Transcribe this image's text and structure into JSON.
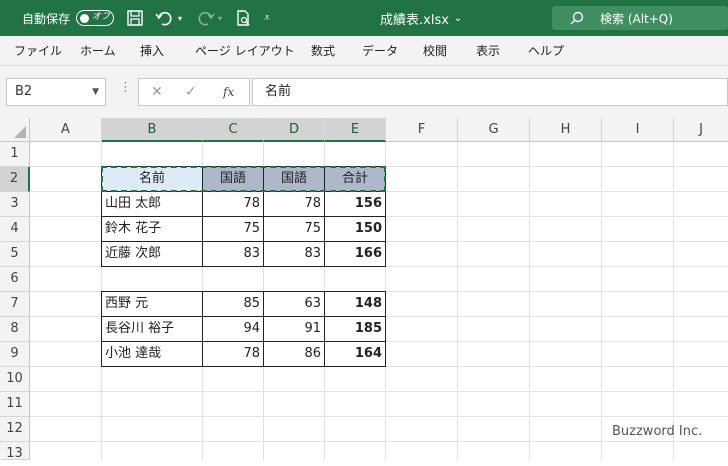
{
  "titlebar": {
    "autosave_label": "自動保存",
    "autosave_state": "オフ",
    "filename": "成績表.xlsx",
    "search_placeholder": "検索 (Alt+Q)"
  },
  "ribbon": {
    "tabs": [
      "ファイル",
      "ホーム",
      "挿入",
      "ページ レイアウト",
      "数式",
      "データ",
      "校閲",
      "表示",
      "ヘルプ"
    ]
  },
  "formula_bar": {
    "name_box": "B2",
    "fx_label": "fx",
    "content": "名前"
  },
  "columns": [
    "A",
    "B",
    "C",
    "D",
    "E",
    "F",
    "G",
    "H",
    "I",
    "J"
  ],
  "rows": [
    "1",
    "2",
    "3",
    "4",
    "5",
    "6",
    "7",
    "8",
    "9",
    "10",
    "11",
    "12",
    "13"
  ],
  "table": {
    "header": [
      "名前",
      "国語",
      "国語",
      "合計"
    ],
    "group1": [
      {
        "name": "山田 太郎",
        "c": "78",
        "d": "78",
        "total": "156"
      },
      {
        "name": "鈴木 花子",
        "c": "75",
        "d": "75",
        "total": "150"
      },
      {
        "name": "近藤 次郎",
        "c": "83",
        "d": "83",
        "total": "166"
      }
    ],
    "group2": [
      {
        "name": "西野 元",
        "c": "85",
        "d": "63",
        "total": "148"
      },
      {
        "name": "長谷川 裕子",
        "c": "94",
        "d": "91",
        "total": "185"
      },
      {
        "name": "小池 達哉",
        "c": "78",
        "d": "86",
        "total": "164"
      }
    ]
  },
  "colors": {
    "accent": "#217346",
    "header_fill": "#adb9ca",
    "first_header_fill": "#ddebf7"
  },
  "watermark": "Buzzword Inc."
}
